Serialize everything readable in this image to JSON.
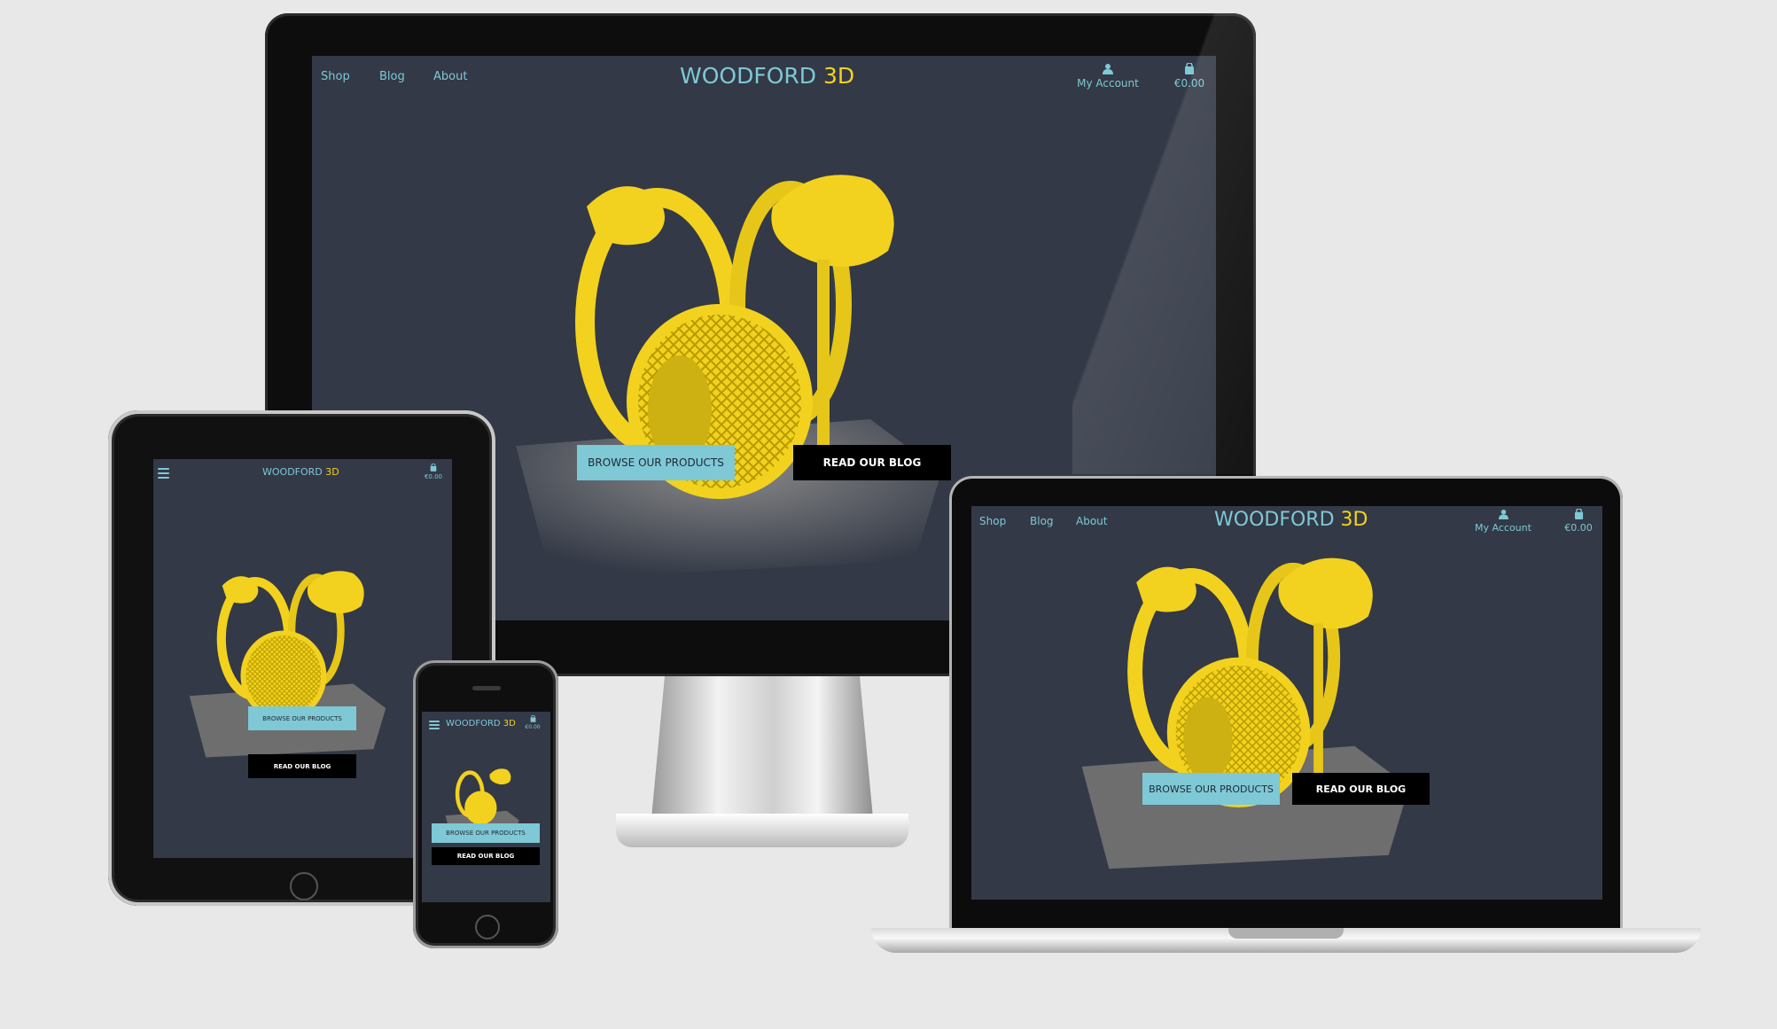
{
  "site": {
    "logo_main": "WOODFORD",
    "logo_accent": "3D",
    "nav": [
      "Shop",
      "Blog",
      "About"
    ],
    "account_label": "My Account",
    "cart_total": "€0.00",
    "cart_total_small": "€0.00",
    "browse_button": "BROWSE OUR PRODUCTS",
    "blog_button": "READ OUR BLOG"
  },
  "colors": {
    "accent": "#7fc8d6",
    "logo_accent": "#f2d21e",
    "background": "#333946",
    "blog_button_bg": "#000000"
  },
  "icons": [
    "hamburger-menu-icon",
    "user-icon",
    "shopping-bag-icon"
  ],
  "devices": [
    "desktop-monitor",
    "tablet",
    "phone",
    "laptop"
  ]
}
